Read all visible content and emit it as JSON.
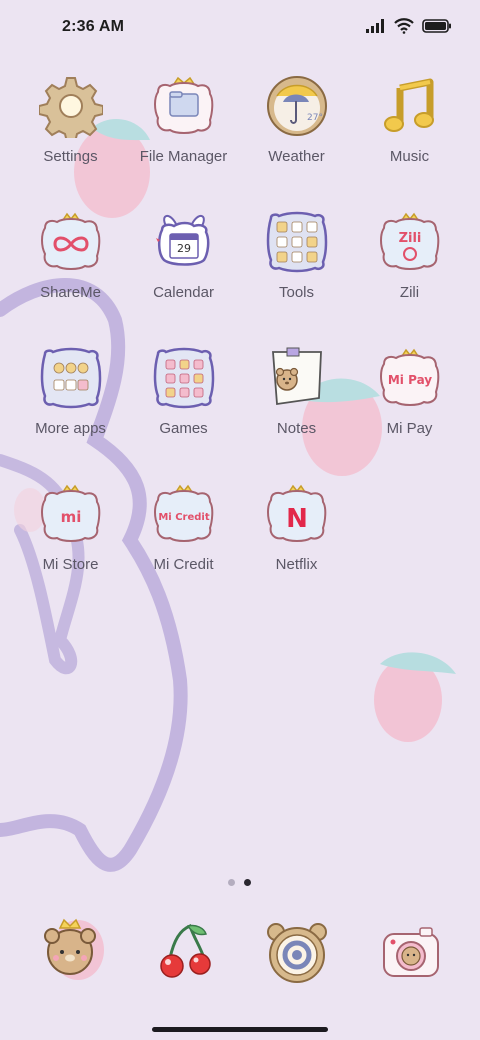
{
  "status_bar": {
    "time": "2:36 AM"
  },
  "apps": [
    {
      "label": "Settings",
      "icon": "gear-icon"
    },
    {
      "label": "File Manager",
      "icon": "folder-icon"
    },
    {
      "label": "Weather",
      "icon": "umbrella-icon",
      "icon_text": "27°"
    },
    {
      "label": "Music",
      "icon": "music-note-icon"
    },
    {
      "label": "ShareMe",
      "icon": "infinity-icon"
    },
    {
      "label": "Calendar",
      "icon": "calendar-icon",
      "icon_text": "29"
    },
    {
      "label": "Tools",
      "icon": "tools-grid-icon"
    },
    {
      "label": "Zili",
      "icon": "zili-icon",
      "icon_text": "Zili"
    },
    {
      "label": "More apps",
      "icon": "apps-grid-icon"
    },
    {
      "label": "Games",
      "icon": "games-grid-icon"
    },
    {
      "label": "Notes",
      "icon": "notes-icon"
    },
    {
      "label": "Mi Pay",
      "icon": "mi-pay-icon",
      "icon_text": "Mi Pay"
    },
    {
      "label": "Mi Store",
      "icon": "mi-store-icon",
      "icon_text": "mi"
    },
    {
      "label": "Mi Credit",
      "icon": "mi-credit-icon",
      "icon_text": "Mi Credit"
    },
    {
      "label": "Netflix",
      "icon": "netflix-icon",
      "icon_text": "N"
    }
  ],
  "dock": [
    {
      "icon": "bear-phone-icon"
    },
    {
      "icon": "cherry-messages-icon"
    },
    {
      "icon": "clock-browser-icon"
    },
    {
      "icon": "camera-icon"
    }
  ],
  "pages": {
    "count": 2,
    "current": 2
  },
  "colors": {
    "background": "#ece4f2",
    "label": "#5b5766",
    "accent_purple": "#8a78c4",
    "strawberry_pink": "#f3b8cc",
    "strawberry_leaf": "#a9dcdc"
  }
}
